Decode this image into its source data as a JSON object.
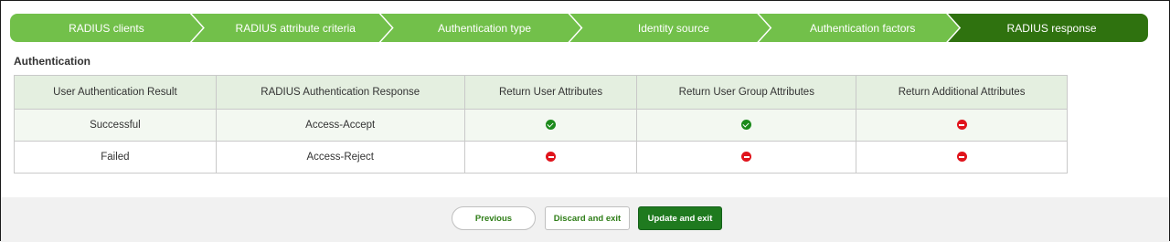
{
  "stepper": {
    "steps": [
      {
        "label": "RADIUS clients",
        "state": "done"
      },
      {
        "label": "RADIUS attribute criteria",
        "state": "done"
      },
      {
        "label": "Authentication type",
        "state": "done"
      },
      {
        "label": "Identity source",
        "state": "done"
      },
      {
        "label": "Authentication factors",
        "state": "done"
      },
      {
        "label": "RADIUS response",
        "state": "active"
      }
    ]
  },
  "section": {
    "title": "Authentication"
  },
  "table": {
    "headers": [
      "User Authentication Result",
      "RADIUS Authentication Response",
      "Return User Attributes",
      "Return User Group Attributes",
      "Return Additional Attributes"
    ],
    "rows": [
      {
        "result": "Successful",
        "response": "Access-Accept",
        "user_attrs": "check-icon",
        "group_attrs": "check-icon",
        "additional_attrs": "minus-circle-icon"
      },
      {
        "result": "Failed",
        "response": "Access-Reject",
        "user_attrs": "minus-circle-icon",
        "group_attrs": "minus-circle-icon",
        "additional_attrs": "minus-circle-icon"
      }
    ]
  },
  "footer": {
    "previous_label": "Previous",
    "discard_label": "Discard and exit",
    "update_label": "Update and exit"
  },
  "colors": {
    "step_done": "#72c04a",
    "step_active": "#2f720f",
    "check": "#1b8a1b",
    "deny": "#e0141c",
    "primary_button": "#1f7a1f"
  }
}
